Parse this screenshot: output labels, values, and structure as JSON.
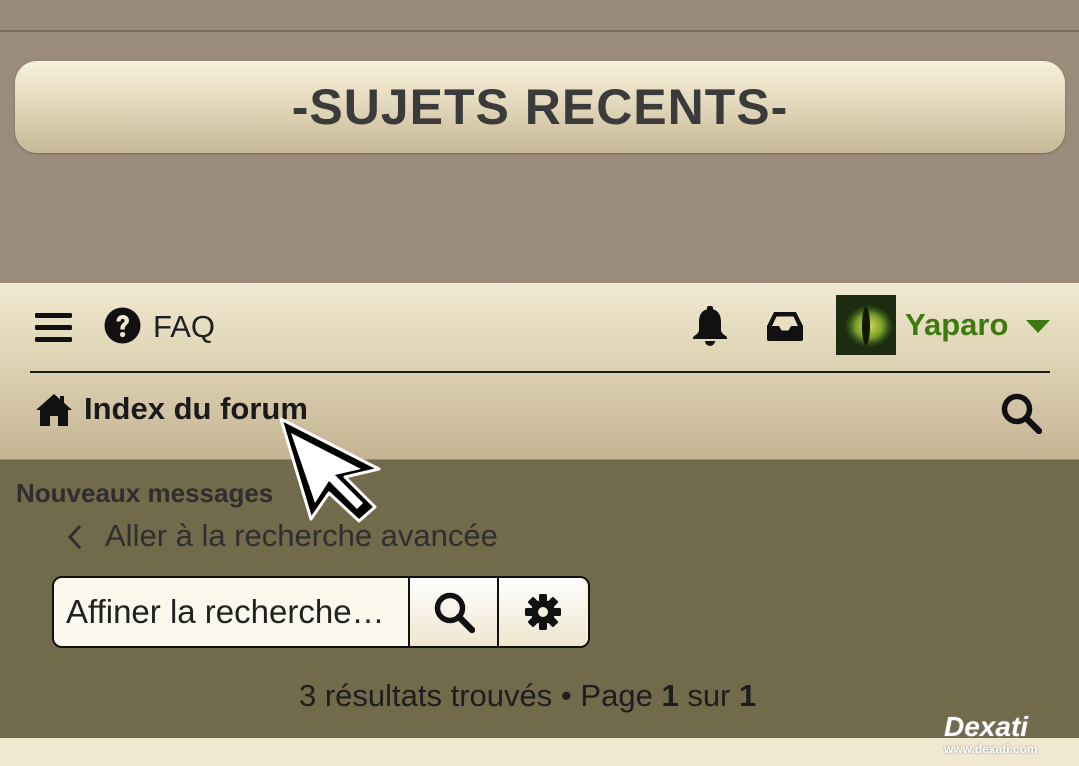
{
  "banner": {
    "title": "-SUJETS RECENTS-"
  },
  "navbar": {
    "faq_label": "FAQ",
    "user": {
      "name": "Yaparo"
    },
    "breadcrumb": {
      "label": "Index du forum"
    },
    "icons": [
      "menu-icon",
      "question-circle-icon",
      "bell-icon",
      "inbox-icon",
      "caret-down-icon",
      "home-icon",
      "search-icon"
    ]
  },
  "content": {
    "section_title": "Nouveaux messages",
    "advanced_search_link": "Aller à la recherche avancée",
    "search": {
      "placeholder": "Affiner la recherche…"
    },
    "results": {
      "count_text": "3 résultats trouvés",
      "separator": "•",
      "page_word": "Page",
      "current_page": "1",
      "of_word": "sur",
      "total_pages": "1"
    }
  },
  "watermark": {
    "brand": "Dexati",
    "url": "www.dexati.com"
  },
  "colors": {
    "username": "#3e7a10",
    "content_bg": "#716a4b",
    "page_bg": "#9b8b7b"
  }
}
